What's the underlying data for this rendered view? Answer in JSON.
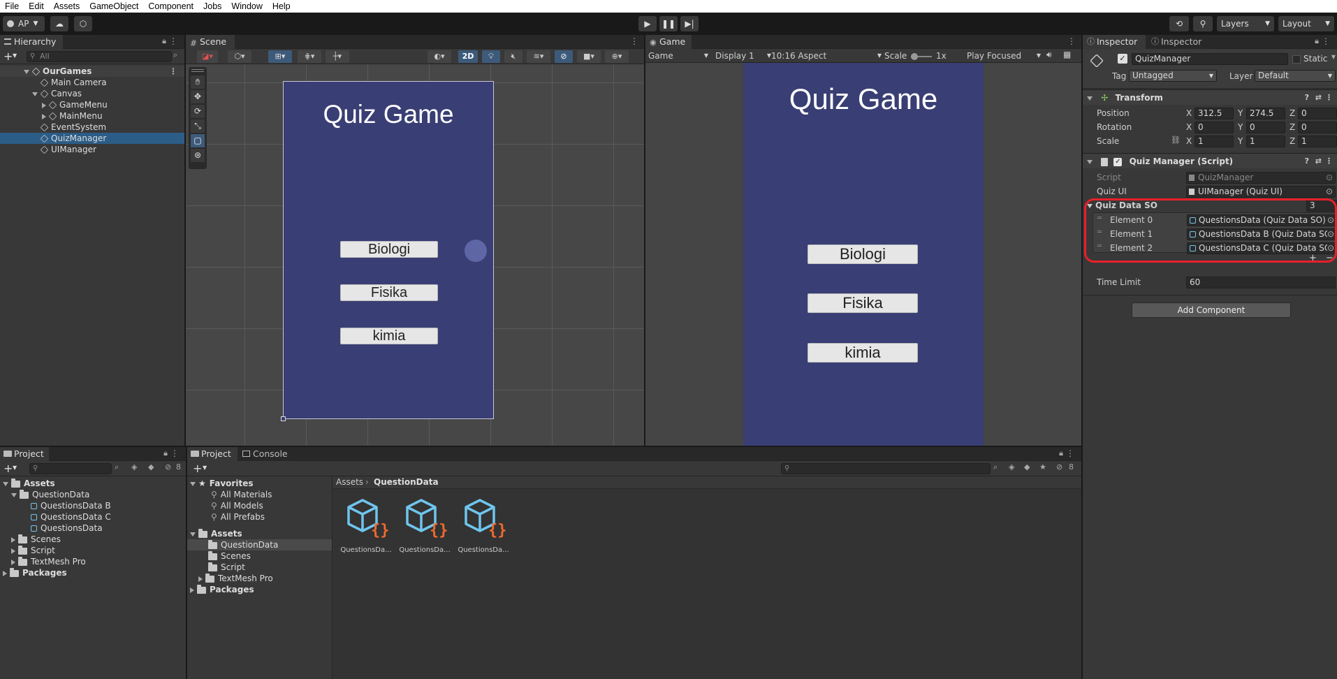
{
  "menu": [
    "File",
    "Edit",
    "Assets",
    "GameObject",
    "Component",
    "Jobs",
    "Window",
    "Help"
  ],
  "toolbar": {
    "account": "AP",
    "layers": "Layers",
    "layout": "Layout"
  },
  "hierarchy": {
    "tab": "Hierarchy",
    "search_placeholder": "All",
    "items": [
      {
        "label": "OurGames"
      },
      {
        "label": "Main Camera"
      },
      {
        "label": "Canvas"
      },
      {
        "label": "GameMenu"
      },
      {
        "label": "MainMenu"
      },
      {
        "label": "EventSystem"
      },
      {
        "label": "QuizManager"
      },
      {
        "label": "UIManager"
      }
    ]
  },
  "scene": {
    "tab": "Scene",
    "mode_2d": "2D",
    "title": "Quiz Game",
    "buttons": [
      "Biologi",
      "Fisika",
      "kimia"
    ]
  },
  "game": {
    "tab": "Game",
    "view": "Game",
    "display": "Display 1",
    "aspect": "10:16 Aspect",
    "scale_label": "Scale",
    "scale_value": "1x",
    "play_mode": "Play Focused",
    "title": "Quiz Game",
    "buttons": [
      "Biologi",
      "Fisika",
      "kimia"
    ]
  },
  "inspector": {
    "tabs": [
      "Inspector",
      "Inspector"
    ],
    "object_name": "QuizManager",
    "static_label": "Static",
    "tag_label": "Tag",
    "tag_value": "Untagged",
    "layer_label": "Layer",
    "layer_value": "Default",
    "transform": {
      "title": "Transform",
      "rows": [
        {
          "label": "Position",
          "x": "312.5",
          "y": "274.5",
          "z": "0"
        },
        {
          "label": "Rotation",
          "x": "0",
          "y": "0",
          "z": "0"
        },
        {
          "label": "Scale",
          "x": "1",
          "y": "1",
          "z": "1"
        }
      ],
      "axes": [
        "X",
        "Y",
        "Z"
      ]
    },
    "script_comp": {
      "title": "Quiz Manager (Script)",
      "script_label": "Script",
      "script_value": "QuizManager",
      "quizui_label": "Quiz UI",
      "quizui_value": "UIManager (Quiz UI)",
      "list_label": "Quiz Data SO",
      "list_count": "3",
      "elements": [
        {
          "label": "Element 0",
          "value": "QuestionsData (Quiz Data SO)"
        },
        {
          "label": "Element 1",
          "value": "QuestionsData B (Quiz Data SO)"
        },
        {
          "label": "Element 2",
          "value": "QuestionsData C (Quiz Data SO)"
        }
      ],
      "time_label": "Time Limit",
      "time_value": "60"
    },
    "add_component": "Add Component",
    "highlight_color": "#e8202a"
  },
  "project_left": {
    "tab": "Project",
    "badge": "8",
    "items": [
      {
        "label": "Assets"
      },
      {
        "label": "QuestionData"
      },
      {
        "label": "QuestionsData B"
      },
      {
        "label": "QuestionsData C"
      },
      {
        "label": "QuestionsData"
      },
      {
        "label": "Scenes"
      },
      {
        "label": "Script"
      },
      {
        "label": "TextMesh Pro"
      },
      {
        "label": "Packages"
      }
    ]
  },
  "project_main": {
    "tabs": [
      "Project",
      "Console"
    ],
    "badge": "8",
    "favorites": "Favorites",
    "fav_items": [
      "All Materials",
      "All Models",
      "All Prefabs"
    ],
    "assets": "Assets",
    "asset_folders": [
      "QuestionData",
      "Scenes",
      "Script",
      "TextMesh Pro"
    ],
    "packages": "Packages",
    "breadcrumb": [
      "Assets",
      "QuestionData"
    ],
    "files": [
      "QuestionsDa...",
      "QuestionsDa...",
      "QuestionsDa..."
    ]
  }
}
